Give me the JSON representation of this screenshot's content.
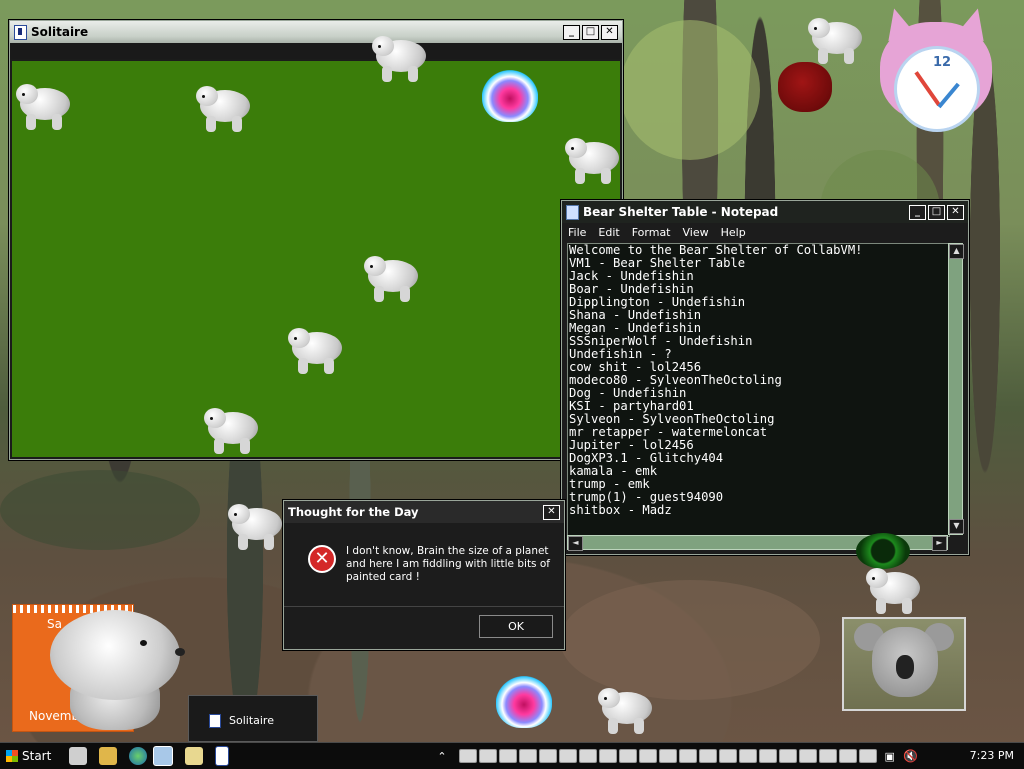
{
  "solitaire": {
    "title": "Solitaire"
  },
  "notepad": {
    "title": "Bear Shelter Table - Notepad",
    "menu": [
      "File",
      "Edit",
      "Format",
      "View",
      "Help"
    ],
    "lines": [
      "Welcome to the Bear Shelter of CollabVM!",
      "VM1 - Bear Shelter Table",
      "Jack - Undefishin",
      "Boar - Undefishin",
      "Dipplington - Undefishin",
      "Shana - Undefishin",
      "Megan - Undefishin",
      "SSSniperWolf - Undefishin",
      "Undefishin - ?",
      "cow shit - lol2456",
      "modeco80 - SylveonTheOctoling",
      "Dog - Undefishin",
      "KSI - partyhard01",
      "Sylveon - SylveonTheOctoling",
      "mr retapper - watermeloncat",
      "Jupiter - lol2456",
      "DogXP3.1 - Glitchy404",
      "kamala - emk",
      "trump - emk",
      "trump(1) - guest94090",
      "shitbox - Madz"
    ]
  },
  "dialog": {
    "title": "Thought for the Day",
    "message": "I don't know, Brain the size of a planet and here I am fiddling with little bits of painted card !",
    "ok_label": "OK"
  },
  "taskbar": {
    "start_label": "Start",
    "time": "7:23 PM",
    "popup_label": "Solitaire"
  },
  "calendar": {
    "day_fragment": "Sa",
    "month_fragment": "Novembe"
  },
  "clock_widget": {
    "number_12": "12"
  },
  "colors": {
    "felt": "#3b7d0a",
    "accent": "#7fa27f"
  }
}
